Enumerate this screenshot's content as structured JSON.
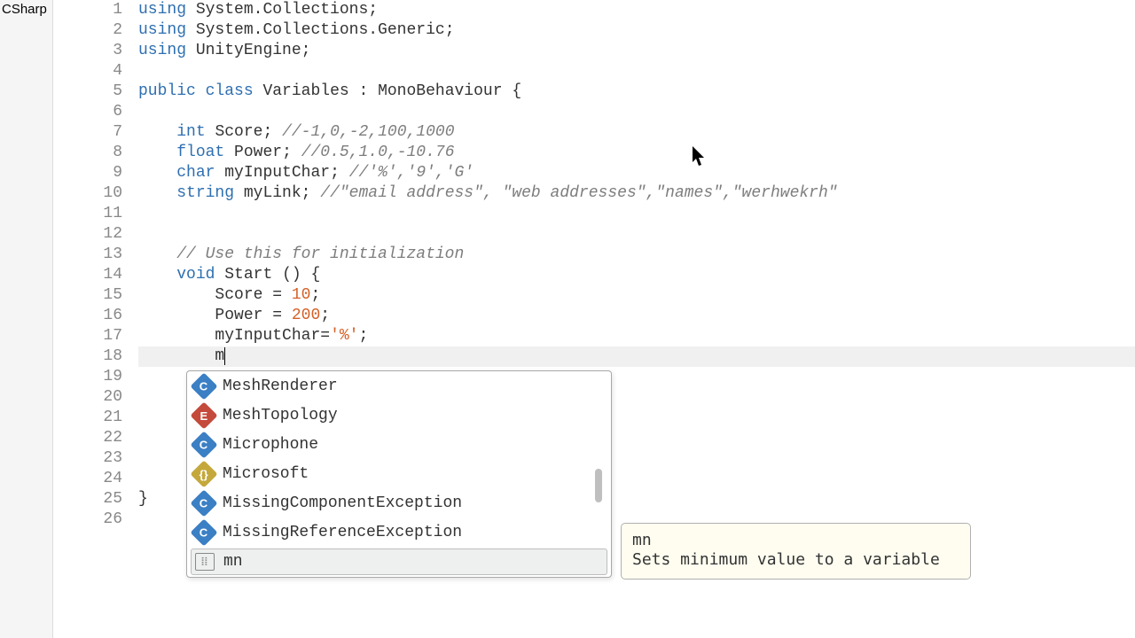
{
  "sidebar": {
    "label": "CSharp"
  },
  "gutter": {
    "start": 1,
    "end": 26
  },
  "code": {
    "lines": [
      {
        "n": 1,
        "tokens": [
          [
            "kw",
            "using"
          ],
          [
            "punct",
            " "
          ],
          [
            "ident",
            "System.Collections"
          ],
          [
            "punct",
            ";"
          ]
        ]
      },
      {
        "n": 2,
        "tokens": [
          [
            "kw",
            "using"
          ],
          [
            "punct",
            " "
          ],
          [
            "ident",
            "System.Collections.Generic"
          ],
          [
            "punct",
            ";"
          ]
        ]
      },
      {
        "n": 3,
        "tokens": [
          [
            "kw",
            "using"
          ],
          [
            "punct",
            " "
          ],
          [
            "ident",
            "UnityEngine"
          ],
          [
            "punct",
            ";"
          ]
        ]
      },
      {
        "n": 4,
        "tokens": []
      },
      {
        "n": 5,
        "tokens": [
          [
            "kw",
            "public"
          ],
          [
            "punct",
            " "
          ],
          [
            "kw",
            "class"
          ],
          [
            "punct",
            " "
          ],
          [
            "cls",
            "Variables"
          ],
          [
            "punct",
            " : "
          ],
          [
            "cls",
            "MonoBehaviour"
          ],
          [
            "punct",
            " {"
          ]
        ]
      },
      {
        "n": 6,
        "tokens": []
      },
      {
        "n": 7,
        "tokens": [
          [
            "punct",
            "    "
          ],
          [
            "type",
            "int"
          ],
          [
            "punct",
            " "
          ],
          [
            "ident",
            "Score"
          ],
          [
            "punct",
            ";"
          ],
          [
            "punct",
            " "
          ],
          [
            "comment",
            "//-1,0,-2,100,1000"
          ]
        ]
      },
      {
        "n": 8,
        "tokens": [
          [
            "punct",
            "    "
          ],
          [
            "type",
            "float"
          ],
          [
            "punct",
            " "
          ],
          [
            "ident",
            "Power"
          ],
          [
            "punct",
            ";"
          ],
          [
            "punct",
            " "
          ],
          [
            "comment",
            "//0.5,1.0,-10.76"
          ]
        ]
      },
      {
        "n": 9,
        "tokens": [
          [
            "punct",
            "    "
          ],
          [
            "type",
            "char"
          ],
          [
            "punct",
            " "
          ],
          [
            "ident",
            "myInputChar"
          ],
          [
            "punct",
            ";"
          ],
          [
            "punct",
            " "
          ],
          [
            "comment",
            "//'%','9','G'"
          ]
        ]
      },
      {
        "n": 10,
        "tokens": [
          [
            "punct",
            "    "
          ],
          [
            "type",
            "string"
          ],
          [
            "punct",
            " "
          ],
          [
            "ident",
            "myLink"
          ],
          [
            "punct",
            ";"
          ],
          [
            "punct",
            " "
          ],
          [
            "comment",
            "//\"email address\", \"web addresses\",\"names\",\"werhwekrh\""
          ]
        ]
      },
      {
        "n": 11,
        "tokens": []
      },
      {
        "n": 12,
        "tokens": []
      },
      {
        "n": 13,
        "tokens": [
          [
            "punct",
            "    "
          ],
          [
            "comment",
            "// Use this for initialization"
          ]
        ]
      },
      {
        "n": 14,
        "tokens": [
          [
            "punct",
            "    "
          ],
          [
            "type",
            "void"
          ],
          [
            "punct",
            " "
          ],
          [
            "ident",
            "Start"
          ],
          [
            "punct",
            " () {"
          ]
        ]
      },
      {
        "n": 15,
        "tokens": [
          [
            "punct",
            "        "
          ],
          [
            "ident",
            "Score"
          ],
          [
            "punct",
            " = "
          ],
          [
            "num",
            "10"
          ],
          [
            "punct",
            ";"
          ]
        ]
      },
      {
        "n": 16,
        "tokens": [
          [
            "punct",
            "        "
          ],
          [
            "ident",
            "Power"
          ],
          [
            "punct",
            " = "
          ],
          [
            "num",
            "200"
          ],
          [
            "punct",
            ";"
          ]
        ]
      },
      {
        "n": 17,
        "tokens": [
          [
            "punct",
            "        "
          ],
          [
            "ident",
            "myInputChar"
          ],
          [
            "punct",
            "="
          ],
          [
            "str",
            "'%'"
          ],
          [
            "punct",
            ";"
          ]
        ]
      },
      {
        "n": 18,
        "tokens": [
          [
            "punct",
            "        "
          ],
          [
            "ident",
            "m"
          ]
        ],
        "caret": true,
        "highlight": true
      },
      {
        "n": 19,
        "tokens": []
      },
      {
        "n": 20,
        "tokens": []
      },
      {
        "n": 21,
        "tokens": []
      },
      {
        "n": 22,
        "tokens": []
      },
      {
        "n": 23,
        "tokens": []
      },
      {
        "n": 24,
        "tokens": []
      },
      {
        "n": 25,
        "tokens": [
          [
            "punct",
            "}"
          ]
        ]
      },
      {
        "n": 26,
        "tokens": []
      }
    ]
  },
  "autocomplete": {
    "items": [
      {
        "icon": "class",
        "glyph": "C",
        "label": "MeshRenderer"
      },
      {
        "icon": "enum",
        "glyph": "E",
        "label": "MeshTopology"
      },
      {
        "icon": "class",
        "glyph": "C",
        "label": "Microphone"
      },
      {
        "icon": "ns",
        "glyph": "{}",
        "label": "Microsoft"
      },
      {
        "icon": "class",
        "glyph": "C",
        "label": "MissingComponentException"
      },
      {
        "icon": "class",
        "glyph": "C",
        "label": "MissingReferenceException"
      },
      {
        "icon": "snip",
        "glyph": "⦙⦙",
        "label": "mn",
        "selected": true
      }
    ]
  },
  "tooltip": {
    "title": "mn",
    "description": "Sets minimum value to a variable"
  }
}
